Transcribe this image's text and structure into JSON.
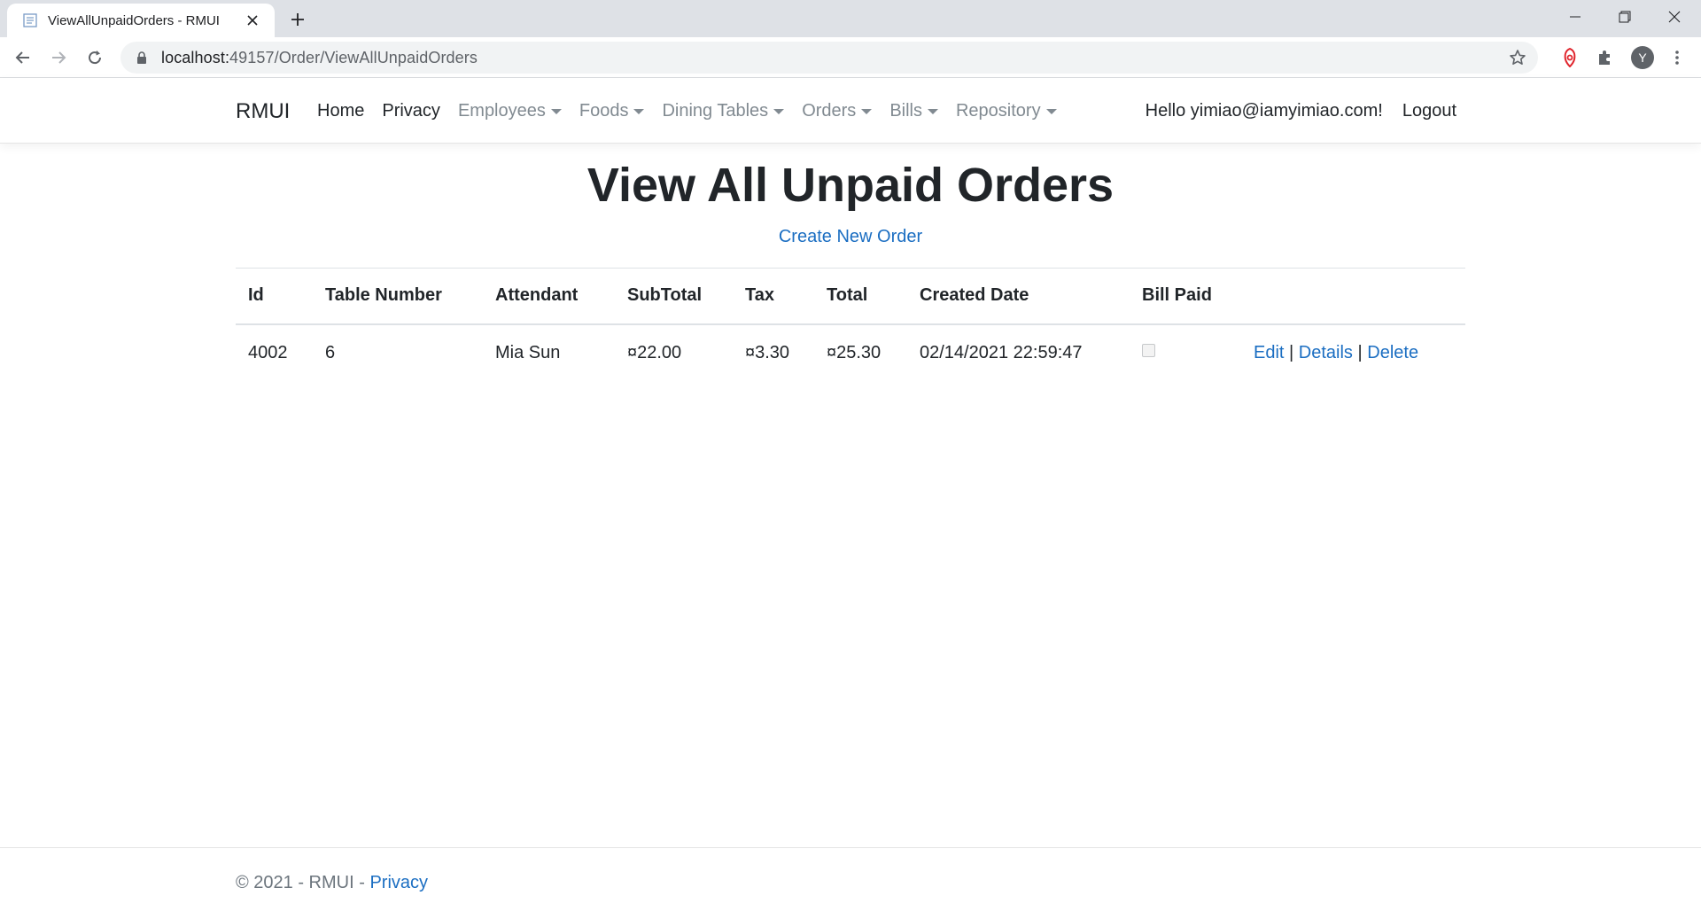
{
  "browser": {
    "tab_title": "ViewAllUnpaidOrders - RMUI",
    "url_host": "localhost:",
    "url_rest": "49157/Order/ViewAllUnpaidOrders",
    "profile_initial": "Y"
  },
  "nav": {
    "brand": "RMUI",
    "links": {
      "home": "Home",
      "privacy": "Privacy",
      "employees": "Employees",
      "foods": "Foods",
      "dining_tables": "Dining Tables",
      "orders": "Orders",
      "bills": "Bills",
      "repository": "Repository"
    },
    "greeting": "Hello yimiao@iamyimiao.com!",
    "logout": "Logout"
  },
  "main": {
    "title": "View All Unpaid Orders",
    "create_link": "Create New Order",
    "table": {
      "headers": [
        "Id",
        "Table Number",
        "Attendant",
        "SubTotal",
        "Tax",
        "Total",
        "Created Date",
        "Bill Paid"
      ],
      "rows": [
        {
          "id": "4002",
          "table_number": "6",
          "attendant": "Mia Sun",
          "subtotal": "¤22.00",
          "tax": "¤3.30",
          "total": "¤25.30",
          "created_date": "02/14/2021 22:59:47",
          "bill_paid": false,
          "actions": {
            "edit": "Edit",
            "details": "Details",
            "delete": "Delete",
            "separator": "|"
          }
        }
      ]
    }
  },
  "footer": {
    "copyright": "© 2021 - RMUI - ",
    "privacy": "Privacy"
  },
  "colors": {
    "link": "#1b6ec2",
    "muted_nav": "#818a91",
    "text": "#212529"
  }
}
